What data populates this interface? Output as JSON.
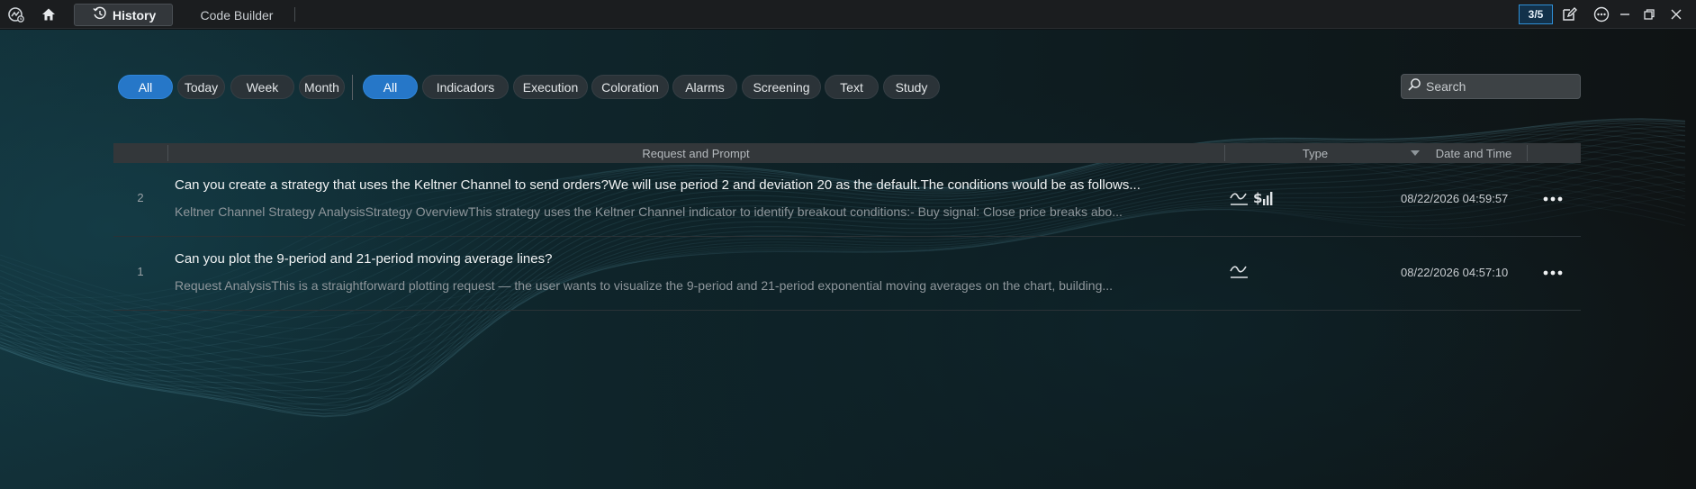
{
  "topbar": {
    "tabs": [
      {
        "label": "History",
        "active": true
      },
      {
        "label": "Code Builder",
        "active": false
      }
    ],
    "counter": "3/5"
  },
  "filters": {
    "time": [
      {
        "label": "All",
        "active": true
      },
      {
        "label": "Today",
        "active": false
      },
      {
        "label": "Week",
        "active": false
      },
      {
        "label": "Month",
        "active": false
      }
    ],
    "category": [
      {
        "label": "All",
        "active": true
      },
      {
        "label": "Indicadors",
        "active": false
      },
      {
        "label": "Execution",
        "active": false
      },
      {
        "label": "Coloration",
        "active": false
      },
      {
        "label": "Alarms",
        "active": false
      },
      {
        "label": "Screening",
        "active": false
      },
      {
        "label": "Text",
        "active": false
      },
      {
        "label": "Study",
        "active": false
      }
    ],
    "search_placeholder": "Search"
  },
  "table": {
    "columns": {
      "request": "Request and Prompt",
      "type": "Type",
      "datetime": "Date and Time"
    },
    "rows": [
      {
        "num": "2",
        "title": "Can you create a strategy that uses the Keltner Channel to send orders?We will use period 2 and deviation 20 as the default.The conditions would be as follows...",
        "summary": "Keltner Channel Strategy AnalysisStrategy OverviewThis strategy uses the Keltner Channel indicator to identify breakout conditions:- Buy signal: Close price breaks abo...",
        "types": [
          "indicator-icon",
          "execution-icon"
        ],
        "datetime": "08/22/2026 04:59:57"
      },
      {
        "num": "1",
        "title": "Can you plot the 9-period and 21-period moving average lines?",
        "summary": "Request AnalysisThis is a straightforward plotting request — the user wants to visualize the 9-period and 21-period exponential moving averages on the chart, building...",
        "types": [
          "indicator-icon"
        ],
        "datetime": "08/22/2026 04:57:10"
      }
    ]
  },
  "colors": {
    "accent": "#2677c8",
    "background": "#0f1416"
  }
}
